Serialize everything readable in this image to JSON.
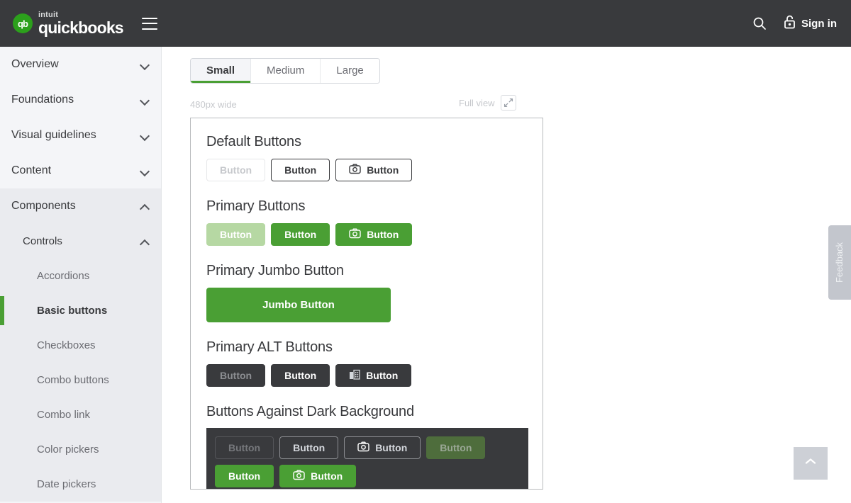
{
  "header": {
    "brand_mark": "qb",
    "brand_top": "intuit",
    "brand_name": "quickbooks",
    "menu_icon": "hamburger-icon",
    "search_icon": "search-icon",
    "lock_icon": "unlocked-padlock-icon",
    "signin_label": "Sign in",
    "background": "#393a3d",
    "accent": "#2ca01c"
  },
  "sidebar": {
    "top_items": [
      {
        "label": "Overview",
        "state": "collapsed"
      },
      {
        "label": "Foundations",
        "state": "collapsed"
      },
      {
        "label": "Visual guidelines",
        "state": "collapsed"
      },
      {
        "label": "Content",
        "state": "collapsed"
      }
    ],
    "expanded_group": {
      "label": "Components",
      "state": "expanded"
    },
    "subgroup": {
      "label": "Controls",
      "state": "expanded"
    },
    "leaf_items": [
      {
        "label": "Accordions",
        "active": false
      },
      {
        "label": "Basic buttons",
        "active": true
      },
      {
        "label": "Checkboxes",
        "active": false
      },
      {
        "label": "Combo buttons",
        "active": false
      },
      {
        "label": "Combo link",
        "active": false
      },
      {
        "label": "Color pickers",
        "active": false
      },
      {
        "label": "Date pickers",
        "active": false
      }
    ],
    "active_indicator_color": "#4a9f34"
  },
  "main": {
    "tabs": [
      {
        "label": "Small",
        "active": true
      },
      {
        "label": "Medium",
        "active": false
      },
      {
        "label": "Large",
        "active": false
      }
    ],
    "width_label": "480px wide",
    "fullview_label": "Full view",
    "fullview_icon": "expand-diagonal-icon"
  },
  "preview": {
    "sections": [
      {
        "title": "Default Buttons",
        "buttons": [
          {
            "label": "Button",
            "variant": "default",
            "disabled": true,
            "icon": null
          },
          {
            "label": "Button",
            "variant": "default",
            "disabled": false,
            "icon": null
          },
          {
            "label": "Button",
            "variant": "default",
            "disabled": false,
            "icon": "camera-icon"
          }
        ]
      },
      {
        "title": "Primary Buttons",
        "buttons": [
          {
            "label": "Button",
            "variant": "primary",
            "disabled": true,
            "icon": null
          },
          {
            "label": "Button",
            "variant": "primary",
            "disabled": false,
            "icon": null
          },
          {
            "label": "Button",
            "variant": "primary",
            "disabled": false,
            "icon": "camera-icon"
          }
        ]
      },
      {
        "title": "Primary Jumbo Button",
        "buttons": [
          {
            "label": "Jumbo Button",
            "variant": "jumbo",
            "disabled": false,
            "icon": null
          }
        ]
      },
      {
        "title": "Primary ALT Buttons",
        "buttons": [
          {
            "label": "Button",
            "variant": "alt",
            "disabled": true,
            "icon": null
          },
          {
            "label": "Button",
            "variant": "alt",
            "disabled": false,
            "icon": null
          },
          {
            "label": "Button",
            "variant": "alt",
            "disabled": false,
            "icon": "building-icon"
          }
        ]
      }
    ],
    "dark_section": {
      "title": "Buttons Against Dark Background",
      "row1": [
        {
          "label": "Button",
          "variant": "ghost",
          "disabled": true,
          "icon": null
        },
        {
          "label": "Button",
          "variant": "ghost",
          "disabled": false,
          "icon": null
        },
        {
          "label": "Button",
          "variant": "ghost",
          "disabled": false,
          "icon": "camera-icon"
        },
        {
          "label": "Button",
          "variant": "solid",
          "disabled": true,
          "icon": null
        }
      ],
      "row2": [
        {
          "label": "Button",
          "variant": "solid",
          "disabled": false,
          "icon": null
        },
        {
          "label": "Button",
          "variant": "solid",
          "disabled": false,
          "icon": "camera-icon"
        }
      ]
    }
  },
  "rail": {
    "feedback_label": "Feedback",
    "scroll_top_icon": "chevron-up-icon"
  },
  "colors": {
    "green": "#4a9f34",
    "green_light": "#b6d8a3",
    "dark": "#393a3d",
    "sidebar_bg": "#f4f5f8",
    "sidebar_bg_expanded": "#eaebef"
  }
}
